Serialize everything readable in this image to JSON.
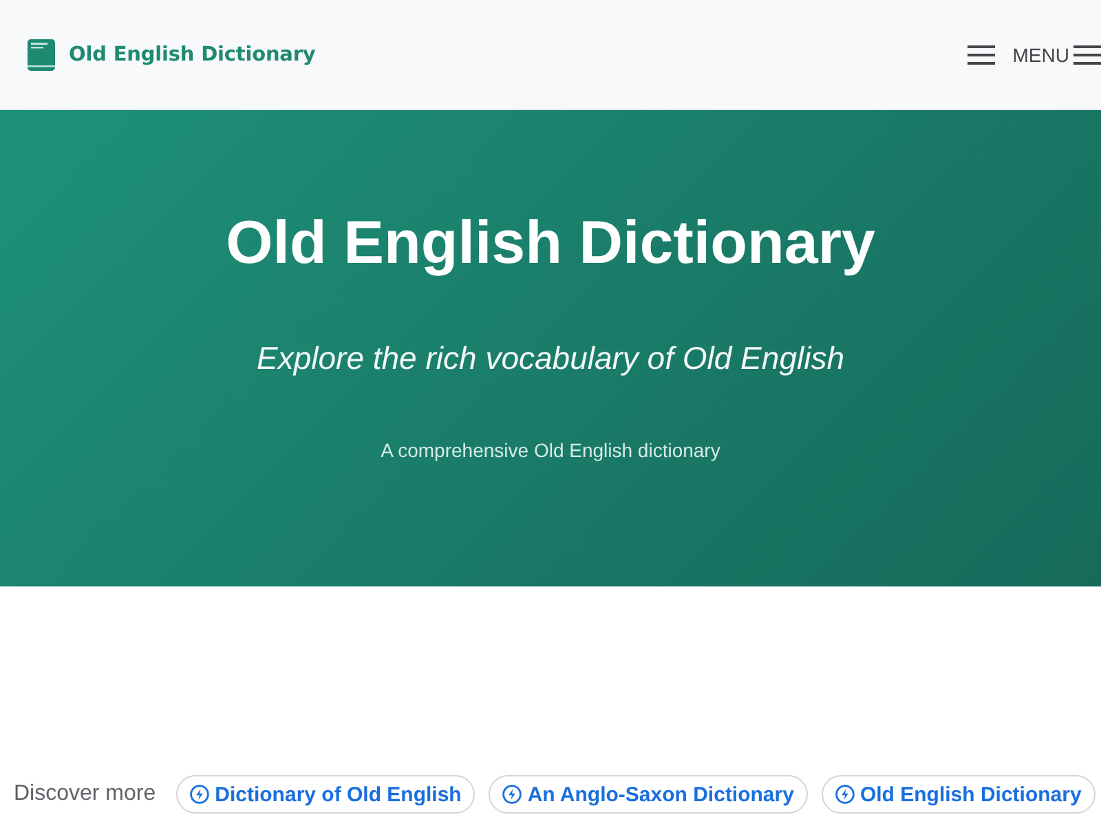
{
  "header": {
    "site_title": "Old English Dictionary",
    "menu_label": "MENU"
  },
  "hero": {
    "title": "Old English Dictionary",
    "subtitle": "Explore the rich vocabulary of Old English",
    "tagline": "A comprehensive Old English dictionary"
  },
  "discover": {
    "label": "Discover more",
    "links": [
      "Dictionary of Old English",
      "An Anglo-Saxon Dictionary",
      "Old English Dictionary"
    ]
  }
}
